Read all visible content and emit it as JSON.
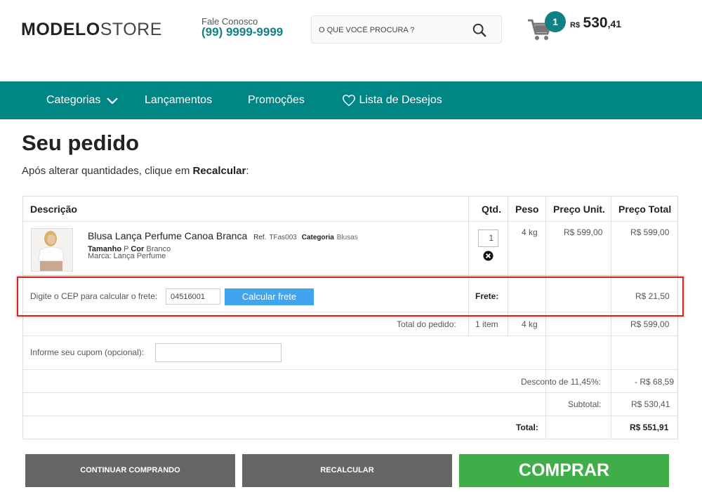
{
  "header": {
    "logo_bold": "MODELO",
    "logo_light": "STORE",
    "contact_label": "Fale Conosco",
    "contact_phone": "(99) 9999-9999",
    "search_placeholder": "O QUE VOCÊ PROCURA ?",
    "cart_count": "1",
    "cart_currency": "R$",
    "cart_total_int": "530",
    "cart_total_dec": ",41"
  },
  "nav": {
    "categorias": "Categorias",
    "lancamentos": "Lançamentos",
    "promocoes": "Promoções",
    "desejos": "Lista de Desejos"
  },
  "page": {
    "title": "Seu pedido",
    "subtitle_prefix": "Após alterar quantidades, clique em ",
    "subtitle_bold": "Recalcular",
    "subtitle_suffix": ":"
  },
  "table": {
    "headers": {
      "descricao": "Descrição",
      "qtd": "Qtd.",
      "peso": "Peso",
      "preco_unit": "Preço Unit.",
      "preco_total": "Preço Total"
    },
    "item": {
      "name": "Blusa Lança Perfume Canoa Branca",
      "ref_label": "Ref.",
      "ref_value": "TFas003",
      "categoria_label": "Categoria",
      "categoria_value": "Blusas",
      "tamanho_label": "Tamanho",
      "tamanho_value": "P",
      "cor_label": "Cor",
      "cor_value": "Branco",
      "marca": "Marca: Lança Perfume",
      "qty": "1",
      "peso": "4 kg",
      "preco_unit": "R$ 599,00",
      "preco_total": "R$ 599,00"
    },
    "frete": {
      "label": "Digite o CEP para calcular o frete:",
      "cep_value": "04516001",
      "button": "Calcular frete",
      "frete_label": "Frete:",
      "frete_value": "R$ 21,50"
    },
    "total_pedido": {
      "label": "Total do pedido:",
      "items": "1 item",
      "peso": "4 kg",
      "value": "R$ 599,00"
    },
    "cupom_label": "Informe seu cupom (opcional):",
    "desconto": {
      "label": "Desconto de 11,45%:",
      "value": "- R$ 68,59"
    },
    "subtotal": {
      "label": "Subtotal:",
      "value": "R$ 530,41"
    },
    "total": {
      "label": "Total:",
      "value": "R$ 551,91"
    }
  },
  "buttons": {
    "continuar": "CONTINUAR COMPRANDO",
    "recalcular": "RECALCULAR",
    "comprar": "COMPRAR"
  },
  "colors": {
    "brand_teal": "#008685",
    "buy_green": "#3fae49",
    "calc_blue": "#41a4ee",
    "highlight_red": "#dd2222"
  }
}
